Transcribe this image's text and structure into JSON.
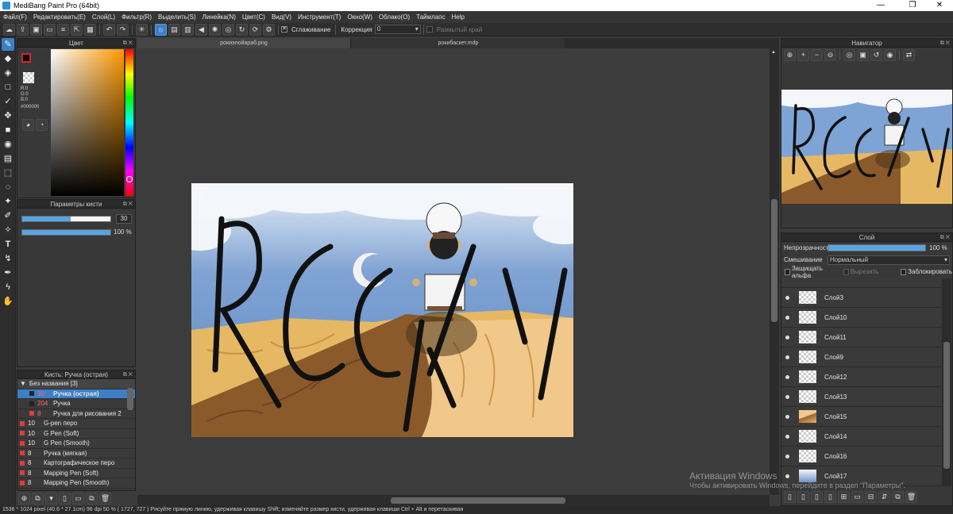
{
  "app": {
    "title": "MediBang Paint Pro (64bit)"
  },
  "menu": [
    "Файл(F)",
    "Редактировать(E)",
    "Слой(L)",
    "Фильтр(R)",
    "Выделить(S)",
    "Линейка(N)",
    "Цвет(C)",
    "Вид(V)",
    "Инструмент(T)",
    "Окно(W)",
    "Облако(O)",
    "Таймлапс",
    "Help"
  ],
  "toolbar": {
    "antialias_label": "Сглаживание",
    "correction_label": "Коррекция",
    "correction_value": "0",
    "blur_edge_label": "Размытый край"
  },
  "color_panel": {
    "title": "Цвет",
    "r": "R:0",
    "g": "G:0",
    "b": "B:0",
    "hex": "#000000"
  },
  "brush_params": {
    "title": "Параметры кисти",
    "size_value": "30",
    "opacity_value": "100 %",
    "size_fraction": 0.55,
    "opacity_fraction": 1.0
  },
  "brush_list": {
    "title": "Кисть: Ручка (острая)",
    "group": "Без названия [3]",
    "items": [
      {
        "size": "30",
        "name": "Ручка (острая)",
        "selected": true
      },
      {
        "size": "204",
        "name": "Ручка"
      },
      {
        "size": "8",
        "name": "Ручка для рисования 2"
      },
      {
        "size": "10",
        "name": "G-pen перо"
      },
      {
        "size": "10",
        "name": "G Pen (Soft)"
      },
      {
        "size": "10",
        "name": "G Pen (Smooth)"
      },
      {
        "size": "8",
        "name": "Ручка (мягкая)"
      },
      {
        "size": "8",
        "name": "Картографическое перо"
      },
      {
        "size": "8",
        "name": "Mapping Pen (Soft)"
      },
      {
        "size": "8",
        "name": "Mapping Pen (Smooth)"
      }
    ]
  },
  "tabs": [
    {
      "label": "рокиэлойараб.png"
    },
    {
      "label": "рокибаскет.mdp"
    }
  ],
  "canvas": {
    "art_text": "ROCKY"
  },
  "navigator": {
    "title": "Навигатор",
    "art_text": "ROCKY"
  },
  "layers": {
    "title": "Слой",
    "opacity_label": "Непрозрачность",
    "opacity_value": "100 %",
    "blend_label": "Смешивание",
    "blend_value": "Нормальный",
    "protect_alpha": "Защищать альфа",
    "clip": "Вырезать",
    "lock": "Заблокировать",
    "items": [
      "Слой3",
      "Слой10",
      "Слой11",
      "Слой9",
      "Слой12",
      "Слой13",
      "Слой15",
      "Слой14",
      "Слой16",
      "Слой17"
    ]
  },
  "status": {
    "text": "1536 * 1024 pixel   (40.6 * 27.1cm)   96 dpi   50 %   ( 1727, 727 )   Рисуйте прямую линию, удерживая клавишу Shift; изменяйте размер кисти, удерживая клавиши Ctrl + Alt и перетаскивая"
  },
  "watermark": {
    "line1": "Активация Windows",
    "line2": "Чтобы активировать Windows, перейдите в раздел \"Параметры\"."
  }
}
